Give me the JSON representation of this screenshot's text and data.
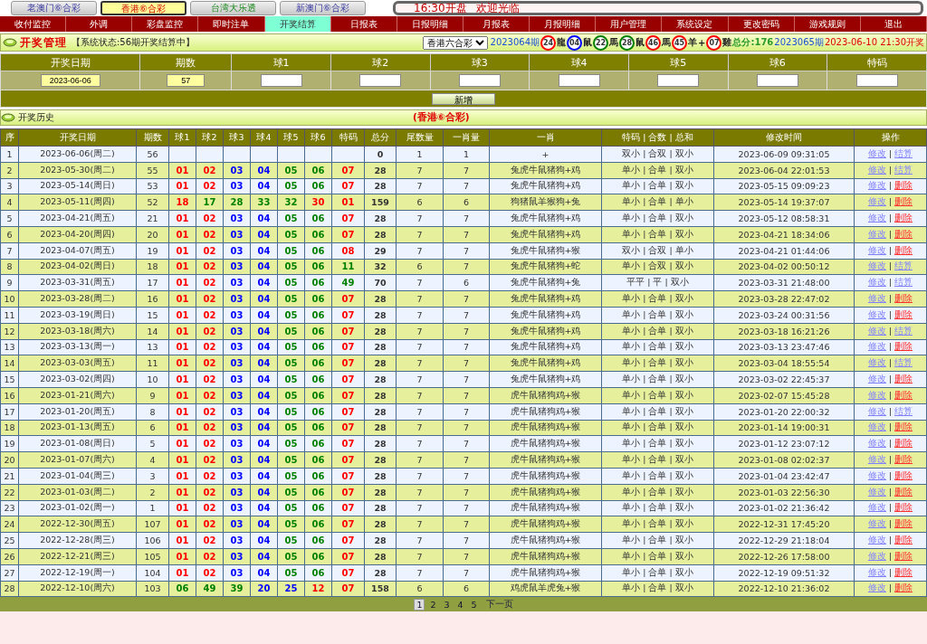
{
  "lottery_tabs": [
    {
      "label": "老澳门⑥合彩",
      "selected": false
    },
    {
      "label": "香港⑥合彩",
      "selected": true
    },
    {
      "label": "台湾大乐透",
      "selected": false
    },
    {
      "label": "新澳门⑥合彩",
      "selected": false
    }
  ],
  "marquee": {
    "time_text": "16:30开盘",
    "welcome": "欢迎光临"
  },
  "nav": [
    {
      "label": "收付监控",
      "selected": false
    },
    {
      "label": "外调",
      "selected": false
    },
    {
      "label": "彩盘监控",
      "selected": false
    },
    {
      "label": "即时注单",
      "selected": false
    },
    {
      "label": "开奖结算",
      "selected": true
    },
    {
      "label": "日报表",
      "selected": false
    },
    {
      "label": "日报明细",
      "selected": false
    },
    {
      "label": "月报表",
      "selected": false
    },
    {
      "label": "月报明细",
      "selected": false
    },
    {
      "label": "用户管理",
      "selected": false
    },
    {
      "label": "系统设定",
      "selected": false
    },
    {
      "label": "更改密码",
      "selected": false
    },
    {
      "label": "游戏规则",
      "selected": false
    },
    {
      "label": "退出",
      "selected": false
    }
  ],
  "status": {
    "title": "开奖管理",
    "system_status": "【系统状态:56期开奖结算中】",
    "lottery_select": "香港六合彩",
    "last_issue": "2023064期",
    "last_balls": [
      {
        "num": "24",
        "zodiac": "龍",
        "color": "#ff0000"
      },
      {
        "num": "04",
        "zodiac": "鼠",
        "color": "#0000ff"
      },
      {
        "num": "22",
        "zodiac": "馬",
        "color": "#008000"
      },
      {
        "num": "28",
        "zodiac": "鼠",
        "color": "#008000"
      },
      {
        "num": "46",
        "zodiac": "馬",
        "color": "#ff0000"
      },
      {
        "num": "45",
        "zodiac": "羊",
        "color": "#ff0000"
      }
    ],
    "plus": "+",
    "special_ball": {
      "num": "07",
      "zodiac": "雞",
      "color": "#ff0000"
    },
    "total": "总分:176",
    "next_issue": "2023065期",
    "next_time": "2023-06-10 21:30开奖"
  },
  "form": {
    "columns": [
      "开奖日期",
      "期数",
      "球1",
      "球2",
      "球3",
      "球4",
      "球5",
      "球6",
      "特码"
    ],
    "date_value": "2023-06-06",
    "issue_value": "57",
    "add_button": "新增"
  },
  "history": {
    "label": "开奖历史",
    "lottery": "(香港⑥合彩)"
  },
  "table": {
    "action_separator": "|",
    "columns": [
      "序",
      "开奖日期",
      "期数",
      "球1",
      "球2",
      "球3",
      "球4",
      "球5",
      "球6",
      "特码",
      "总分",
      "尾数量",
      "一肖量",
      "一肖",
      "特码 | 合数 | 总和",
      "修改时间",
      "操作"
    ],
    "rows": [
      {
        "seq": "1",
        "date": "2023-06-06(周二)",
        "issue": "56",
        "total": "0",
        "tail": "1",
        "zcount": "1",
        "zodiac": "+",
        "summary": "双小 | 合双 | 双小",
        "modified": "2023-06-09 09:31:05",
        "actions": [
          {
            "label": "修改",
            "kind": "edit"
          },
          {
            "label": "结算",
            "kind": "settle"
          }
        ]
      },
      {
        "seq": "2",
        "date": "2023-05-30(周二)",
        "issue": "55",
        "balls": [
          {
            "num": "01",
            "color": "#ff0000"
          },
          {
            "num": "02",
            "color": "#ff0000"
          },
          {
            "num": "03",
            "color": "#0000ff"
          },
          {
            "num": "04",
            "color": "#0000ff"
          },
          {
            "num": "05",
            "color": "#008000"
          },
          {
            "num": "06",
            "color": "#008000"
          },
          {
            "num": "07",
            "color": "#ff0000"
          }
        ],
        "total": "28",
        "tail": "7",
        "zcount": "7",
        "zodiac": "兔虎牛鼠猪狗+鸡",
        "summary": "单小 | 合单 | 双小",
        "modified": "2023-06-04 22:01:53",
        "actions": [
          {
            "label": "修改",
            "kind": "edit"
          },
          {
            "label": "结算",
            "kind": "settle"
          }
        ]
      },
      {
        "seq": "3",
        "date": "2023-05-14(周日)",
        "issue": "53",
        "balls": [
          {
            "num": "01",
            "color": "#ff0000"
          },
          {
            "num": "02",
            "color": "#ff0000"
          },
          {
            "num": "03",
            "color": "#0000ff"
          },
          {
            "num": "04",
            "color": "#0000ff"
          },
          {
            "num": "05",
            "color": "#008000"
          },
          {
            "num": "06",
            "color": "#008000"
          },
          {
            "num": "07",
            "color": "#ff0000"
          }
        ],
        "total": "28",
        "tail": "7",
        "zcount": "7",
        "zodiac": "兔虎牛鼠猪狗+鸡",
        "summary": "单小 | 合单 | 双小",
        "modified": "2023-05-15 09:09:23",
        "actions": [
          {
            "label": "修改",
            "kind": "edit"
          },
          {
            "label": "删除",
            "kind": "delete"
          }
        ]
      },
      {
        "seq": "4",
        "date": "2023-05-11(周四)",
        "issue": "52",
        "balls": [
          {
            "num": "18",
            "color": "#ff0000"
          },
          {
            "num": "17",
            "color": "#008000"
          },
          {
            "num": "28",
            "color": "#008000"
          },
          {
            "num": "33",
            "color": "#008000"
          },
          {
            "num": "32",
            "color": "#008000"
          },
          {
            "num": "30",
            "color": "#ff0000"
          },
          {
            "num": "01",
            "color": "#ff0000"
          }
        ],
        "total": "159",
        "tail": "6",
        "zcount": "6",
        "zodiac": "狗猪鼠羊猴狗+兔",
        "summary": "单小 | 合单 | 单小",
        "modified": "2023-05-14 19:37:07",
        "actions": [
          {
            "label": "修改",
            "kind": "edit"
          },
          {
            "label": "删除",
            "kind": "delete"
          }
        ]
      },
      {
        "seq": "5",
        "date": "2023-04-21(周五)",
        "issue": "21",
        "balls": [
          {
            "num": "01",
            "color": "#ff0000"
          },
          {
            "num": "02",
            "color": "#ff0000"
          },
          {
            "num": "03",
            "color": "#0000ff"
          },
          {
            "num": "04",
            "color": "#0000ff"
          },
          {
            "num": "05",
            "color": "#008000"
          },
          {
            "num": "06",
            "color": "#008000"
          },
          {
            "num": "07",
            "color": "#ff0000"
          }
        ],
        "total": "28",
        "tail": "7",
        "zcount": "7",
        "zodiac": "兔虎牛鼠猪狗+鸡",
        "summary": "单小 | 合单 | 双小",
        "modified": "2023-05-12 08:58:31",
        "actions": [
          {
            "label": "修改",
            "kind": "edit"
          },
          {
            "label": "删除",
            "kind": "delete"
          }
        ]
      },
      {
        "seq": "6",
        "date": "2023-04-20(周四)",
        "issue": "20",
        "balls": [
          {
            "num": "01",
            "color": "#ff0000"
          },
          {
            "num": "02",
            "color": "#ff0000"
          },
          {
            "num": "03",
            "color": "#0000ff"
          },
          {
            "num": "04",
            "color": "#0000ff"
          },
          {
            "num": "05",
            "color": "#008000"
          },
          {
            "num": "06",
            "color": "#008000"
          },
          {
            "num": "07",
            "color": "#ff0000"
          }
        ],
        "total": "28",
        "tail": "7",
        "zcount": "7",
        "zodiac": "兔虎牛鼠猪狗+鸡",
        "summary": "单小 | 合单 | 双小",
        "modified": "2023-04-21 18:34:06",
        "actions": [
          {
            "label": "修改",
            "kind": "edit"
          },
          {
            "label": "删除",
            "kind": "delete"
          }
        ]
      },
      {
        "seq": "7",
        "date": "2023-04-07(周五)",
        "issue": "19",
        "balls": [
          {
            "num": "01",
            "color": "#ff0000"
          },
          {
            "num": "02",
            "color": "#ff0000"
          },
          {
            "num": "03",
            "color": "#0000ff"
          },
          {
            "num": "04",
            "color": "#0000ff"
          },
          {
            "num": "05",
            "color": "#008000"
          },
          {
            "num": "06",
            "color": "#008000"
          },
          {
            "num": "08",
            "color": "#ff0000"
          }
        ],
        "total": "29",
        "tail": "7",
        "zcount": "7",
        "zodiac": "兔虎牛鼠猪狗+猴",
        "summary": "双小 | 合双 | 单小",
        "modified": "2023-04-21 01:44:06",
        "actions": [
          {
            "label": "修改",
            "kind": "edit"
          },
          {
            "label": "删除",
            "kind": "delete"
          }
        ]
      },
      {
        "seq": "8",
        "date": "2023-04-02(周日)",
        "issue": "18",
        "balls": [
          {
            "num": "01",
            "color": "#ff0000"
          },
          {
            "num": "02",
            "color": "#ff0000"
          },
          {
            "num": "03",
            "color": "#0000ff"
          },
          {
            "num": "04",
            "color": "#0000ff"
          },
          {
            "num": "05",
            "color": "#008000"
          },
          {
            "num": "06",
            "color": "#008000"
          },
          {
            "num": "11",
            "color": "#008000"
          }
        ],
        "total": "32",
        "tail": "6",
        "zcount": "7",
        "zodiac": "兔虎牛鼠猪狗+蛇",
        "summary": "单小 | 合双 | 双小",
        "modified": "2023-04-02 00:50:12",
        "actions": [
          {
            "label": "修改",
            "kind": "edit"
          },
          {
            "label": "结算",
            "kind": "settle"
          }
        ]
      },
      {
        "seq": "9",
        "date": "2023-03-31(周五)",
        "issue": "17",
        "balls": [
          {
            "num": "01",
            "color": "#ff0000"
          },
          {
            "num": "02",
            "color": "#ff0000"
          },
          {
            "num": "03",
            "color": "#0000ff"
          },
          {
            "num": "04",
            "color": "#0000ff"
          },
          {
            "num": "05",
            "color": "#008000"
          },
          {
            "num": "06",
            "color": "#008000"
          },
          {
            "num": "49",
            "color": "#008000"
          }
        ],
        "total": "70",
        "tail": "7",
        "zcount": "6",
        "zodiac": "兔虎牛鼠猪狗+兔",
        "summary": "平平 | 平 | 双小",
        "modified": "2023-03-31 21:48:00",
        "actions": [
          {
            "label": "修改",
            "kind": "edit"
          },
          {
            "label": "结算",
            "kind": "settle"
          }
        ]
      },
      {
        "seq": "10",
        "date": "2023-03-28(周二)",
        "issue": "16",
        "balls": [
          {
            "num": "01",
            "color": "#ff0000"
          },
          {
            "num": "02",
            "color": "#ff0000"
          },
          {
            "num": "03",
            "color": "#0000ff"
          },
          {
            "num": "04",
            "color": "#0000ff"
          },
          {
            "num": "05",
            "color": "#008000"
          },
          {
            "num": "06",
            "color": "#008000"
          },
          {
            "num": "07",
            "color": "#ff0000"
          }
        ],
        "total": "28",
        "tail": "7",
        "zcount": "7",
        "zodiac": "兔虎牛鼠猪狗+鸡",
        "summary": "单小 | 合单 | 双小",
        "modified": "2023-03-28 22:47:02",
        "actions": [
          {
            "label": "修改",
            "kind": "edit"
          },
          {
            "label": "删除",
            "kind": "delete"
          }
        ]
      },
      {
        "seq": "11",
        "date": "2023-03-19(周日)",
        "issue": "15",
        "balls": [
          {
            "num": "01",
            "color": "#ff0000"
          },
          {
            "num": "02",
            "color": "#ff0000"
          },
          {
            "num": "03",
            "color": "#0000ff"
          },
          {
            "num": "04",
            "color": "#0000ff"
          },
          {
            "num": "05",
            "color": "#008000"
          },
          {
            "num": "06",
            "color": "#008000"
          },
          {
            "num": "07",
            "color": "#ff0000"
          }
        ],
        "total": "28",
        "tail": "7",
        "zcount": "7",
        "zodiac": "兔虎牛鼠猪狗+鸡",
        "summary": "单小 | 合单 | 双小",
        "modified": "2023-03-24 00:31:56",
        "actions": [
          {
            "label": "修改",
            "kind": "edit"
          },
          {
            "label": "删除",
            "kind": "delete"
          }
        ]
      },
      {
        "seq": "12",
        "date": "2023-03-18(周六)",
        "issue": "14",
        "balls": [
          {
            "num": "01",
            "color": "#ff0000"
          },
          {
            "num": "02",
            "color": "#ff0000"
          },
          {
            "num": "03",
            "color": "#0000ff"
          },
          {
            "num": "04",
            "color": "#0000ff"
          },
          {
            "num": "05",
            "color": "#008000"
          },
          {
            "num": "06",
            "color": "#008000"
          },
          {
            "num": "07",
            "color": "#ff0000"
          }
        ],
        "total": "28",
        "tail": "7",
        "zcount": "7",
        "zodiac": "兔虎牛鼠猪狗+鸡",
        "summary": "单小 | 合单 | 双小",
        "modified": "2023-03-18 16:21:26",
        "actions": [
          {
            "label": "修改",
            "kind": "edit"
          },
          {
            "label": "结算",
            "kind": "settle"
          }
        ]
      },
      {
        "seq": "13",
        "date": "2023-03-13(周一)",
        "issue": "13",
        "balls": [
          {
            "num": "01",
            "color": "#ff0000"
          },
          {
            "num": "02",
            "color": "#ff0000"
          },
          {
            "num": "03",
            "color": "#0000ff"
          },
          {
            "num": "04",
            "color": "#0000ff"
          },
          {
            "num": "05",
            "color": "#008000"
          },
          {
            "num": "06",
            "color": "#008000"
          },
          {
            "num": "07",
            "color": "#ff0000"
          }
        ],
        "total": "28",
        "tail": "7",
        "zcount": "7",
        "zodiac": "兔虎牛鼠猪狗+鸡",
        "summary": "单小 | 合单 | 双小",
        "modified": "2023-03-13 23:47:46",
        "actions": [
          {
            "label": "修改",
            "kind": "edit"
          },
          {
            "label": "删除",
            "kind": "delete"
          }
        ]
      },
      {
        "seq": "14",
        "date": "2023-03-03(周五)",
        "issue": "11",
        "balls": [
          {
            "num": "01",
            "color": "#ff0000"
          },
          {
            "num": "02",
            "color": "#ff0000"
          },
          {
            "num": "03",
            "color": "#0000ff"
          },
          {
            "num": "04",
            "color": "#0000ff"
          },
          {
            "num": "05",
            "color": "#008000"
          },
          {
            "num": "06",
            "color": "#008000"
          },
          {
            "num": "07",
            "color": "#ff0000"
          }
        ],
        "total": "28",
        "tail": "7",
        "zcount": "7",
        "zodiac": "兔虎牛鼠猪狗+鸡",
        "summary": "单小 | 合单 | 双小",
        "modified": "2023-03-04 18:55:54",
        "actions": [
          {
            "label": "修改",
            "kind": "edit"
          },
          {
            "label": "结算",
            "kind": "settle"
          }
        ]
      },
      {
        "seq": "15",
        "date": "2023-03-02(周四)",
        "issue": "10",
        "balls": [
          {
            "num": "01",
            "color": "#ff0000"
          },
          {
            "num": "02",
            "color": "#ff0000"
          },
          {
            "num": "03",
            "color": "#0000ff"
          },
          {
            "num": "04",
            "color": "#0000ff"
          },
          {
            "num": "05",
            "color": "#008000"
          },
          {
            "num": "06",
            "color": "#008000"
          },
          {
            "num": "07",
            "color": "#ff0000"
          }
        ],
        "total": "28",
        "tail": "7",
        "zcount": "7",
        "zodiac": "兔虎牛鼠猪狗+鸡",
        "summary": "单小 | 合单 | 双小",
        "modified": "2023-03-02 22:45:37",
        "actions": [
          {
            "label": "修改",
            "kind": "edit"
          },
          {
            "label": "删除",
            "kind": "delete"
          }
        ]
      },
      {
        "seq": "16",
        "date": "2023-01-21(周六)",
        "issue": "9",
        "balls": [
          {
            "num": "01",
            "color": "#ff0000"
          },
          {
            "num": "02",
            "color": "#ff0000"
          },
          {
            "num": "03",
            "color": "#0000ff"
          },
          {
            "num": "04",
            "color": "#0000ff"
          },
          {
            "num": "05",
            "color": "#008000"
          },
          {
            "num": "06",
            "color": "#008000"
          },
          {
            "num": "07",
            "color": "#ff0000"
          }
        ],
        "total": "28",
        "tail": "7",
        "zcount": "7",
        "zodiac": "虎牛鼠猪狗鸡+猴",
        "summary": "单小 | 合单 | 双小",
        "modified": "2023-02-07 15:45:28",
        "actions": [
          {
            "label": "修改",
            "kind": "edit"
          },
          {
            "label": "删除",
            "kind": "delete"
          }
        ]
      },
      {
        "seq": "17",
        "date": "2023-01-20(周五)",
        "issue": "8",
        "balls": [
          {
            "num": "01",
            "color": "#ff0000"
          },
          {
            "num": "02",
            "color": "#ff0000"
          },
          {
            "num": "03",
            "color": "#0000ff"
          },
          {
            "num": "04",
            "color": "#0000ff"
          },
          {
            "num": "05",
            "color": "#008000"
          },
          {
            "num": "06",
            "color": "#008000"
          },
          {
            "num": "07",
            "color": "#ff0000"
          }
        ],
        "total": "28",
        "tail": "7",
        "zcount": "7",
        "zodiac": "虎牛鼠猪狗鸡+猴",
        "summary": "单小 | 合单 | 双小",
        "modified": "2023-01-20 22:00:32",
        "actions": [
          {
            "label": "修改",
            "kind": "edit"
          },
          {
            "label": "结算",
            "kind": "settle"
          }
        ]
      },
      {
        "seq": "18",
        "date": "2023-01-13(周五)",
        "issue": "6",
        "balls": [
          {
            "num": "01",
            "color": "#ff0000"
          },
          {
            "num": "02",
            "color": "#ff0000"
          },
          {
            "num": "03",
            "color": "#0000ff"
          },
          {
            "num": "04",
            "color": "#0000ff"
          },
          {
            "num": "05",
            "color": "#008000"
          },
          {
            "num": "06",
            "color": "#008000"
          },
          {
            "num": "07",
            "color": "#ff0000"
          }
        ],
        "total": "28",
        "tail": "7",
        "zcount": "7",
        "zodiac": "虎牛鼠猪狗鸡+猴",
        "summary": "单小 | 合单 | 双小",
        "modified": "2023-01-14 19:00:31",
        "actions": [
          {
            "label": "修改",
            "kind": "edit"
          },
          {
            "label": "删除",
            "kind": "delete"
          }
        ]
      },
      {
        "seq": "19",
        "date": "2023-01-08(周日)",
        "issue": "5",
        "balls": [
          {
            "num": "01",
            "color": "#ff0000"
          },
          {
            "num": "02",
            "color": "#ff0000"
          },
          {
            "num": "03",
            "color": "#0000ff"
          },
          {
            "num": "04",
            "color": "#0000ff"
          },
          {
            "num": "05",
            "color": "#008000"
          },
          {
            "num": "06",
            "color": "#008000"
          },
          {
            "num": "07",
            "color": "#ff0000"
          }
        ],
        "total": "28",
        "tail": "7",
        "zcount": "7",
        "zodiac": "虎牛鼠猪狗鸡+猴",
        "summary": "单小 | 合单 | 双小",
        "modified": "2023-01-12 23:07:12",
        "actions": [
          {
            "label": "修改",
            "kind": "edit"
          },
          {
            "label": "删除",
            "kind": "delete"
          }
        ]
      },
      {
        "seq": "20",
        "date": "2023-01-07(周六)",
        "issue": "4",
        "balls": [
          {
            "num": "01",
            "color": "#ff0000"
          },
          {
            "num": "02",
            "color": "#ff0000"
          },
          {
            "num": "03",
            "color": "#0000ff"
          },
          {
            "num": "04",
            "color": "#0000ff"
          },
          {
            "num": "05",
            "color": "#008000"
          },
          {
            "num": "06",
            "color": "#008000"
          },
          {
            "num": "07",
            "color": "#ff0000"
          }
        ],
        "total": "28",
        "tail": "7",
        "zcount": "7",
        "zodiac": "虎牛鼠猪狗鸡+猴",
        "summary": "单小 | 合单 | 双小",
        "modified": "2023-01-08 02:02:37",
        "actions": [
          {
            "label": "修改",
            "kind": "edit"
          },
          {
            "label": "删除",
            "kind": "delete"
          }
        ]
      },
      {
        "seq": "21",
        "date": "2023-01-04(周三)",
        "issue": "3",
        "balls": [
          {
            "num": "01",
            "color": "#ff0000"
          },
          {
            "num": "02",
            "color": "#ff0000"
          },
          {
            "num": "03",
            "color": "#0000ff"
          },
          {
            "num": "04",
            "color": "#0000ff"
          },
          {
            "num": "05",
            "color": "#008000"
          },
          {
            "num": "06",
            "color": "#008000"
          },
          {
            "num": "07",
            "color": "#ff0000"
          }
        ],
        "total": "28",
        "tail": "7",
        "zcount": "7",
        "zodiac": "虎牛鼠猪狗鸡+猴",
        "summary": "单小 | 合单 | 双小",
        "modified": "2023-01-04 23:42:47",
        "actions": [
          {
            "label": "修改",
            "kind": "edit"
          },
          {
            "label": "删除",
            "kind": "delete"
          }
        ]
      },
      {
        "seq": "22",
        "date": "2023-01-03(周二)",
        "issue": "2",
        "balls": [
          {
            "num": "01",
            "color": "#ff0000"
          },
          {
            "num": "02",
            "color": "#ff0000"
          },
          {
            "num": "03",
            "color": "#0000ff"
          },
          {
            "num": "04",
            "color": "#0000ff"
          },
          {
            "num": "05",
            "color": "#008000"
          },
          {
            "num": "06",
            "color": "#008000"
          },
          {
            "num": "07",
            "color": "#ff0000"
          }
        ],
        "total": "28",
        "tail": "7",
        "zcount": "7",
        "zodiac": "虎牛鼠猪狗鸡+猴",
        "summary": "单小 | 合单 | 双小",
        "modified": "2023-01-03 22:56:30",
        "actions": [
          {
            "label": "修改",
            "kind": "edit"
          },
          {
            "label": "删除",
            "kind": "delete"
          }
        ]
      },
      {
        "seq": "23",
        "date": "2023-01-02(周一)",
        "issue": "1",
        "balls": [
          {
            "num": "01",
            "color": "#ff0000"
          },
          {
            "num": "02",
            "color": "#ff0000"
          },
          {
            "num": "03",
            "color": "#0000ff"
          },
          {
            "num": "04",
            "color": "#0000ff"
          },
          {
            "num": "05",
            "color": "#008000"
          },
          {
            "num": "06",
            "color": "#008000"
          },
          {
            "num": "07",
            "color": "#ff0000"
          }
        ],
        "total": "28",
        "tail": "7",
        "zcount": "7",
        "zodiac": "虎牛鼠猪狗鸡+猴",
        "summary": "单小 | 合单 | 双小",
        "modified": "2023-01-02 21:36:42",
        "actions": [
          {
            "label": "修改",
            "kind": "edit"
          },
          {
            "label": "删除",
            "kind": "delete"
          }
        ]
      },
      {
        "seq": "24",
        "date": "2022-12-30(周五)",
        "issue": "107",
        "balls": [
          {
            "num": "01",
            "color": "#ff0000"
          },
          {
            "num": "02",
            "color": "#ff0000"
          },
          {
            "num": "03",
            "color": "#0000ff"
          },
          {
            "num": "04",
            "color": "#0000ff"
          },
          {
            "num": "05",
            "color": "#008000"
          },
          {
            "num": "06",
            "color": "#008000"
          },
          {
            "num": "07",
            "color": "#ff0000"
          }
        ],
        "total": "28",
        "tail": "7",
        "zcount": "7",
        "zodiac": "虎牛鼠猪狗鸡+猴",
        "summary": "单小 | 合单 | 双小",
        "modified": "2022-12-31 17:45:20",
        "actions": [
          {
            "label": "修改",
            "kind": "edit"
          },
          {
            "label": "删除",
            "kind": "delete"
          }
        ]
      },
      {
        "seq": "25",
        "date": "2022-12-28(周三)",
        "issue": "106",
        "balls": [
          {
            "num": "01",
            "color": "#ff0000"
          },
          {
            "num": "02",
            "color": "#ff0000"
          },
          {
            "num": "03",
            "color": "#0000ff"
          },
          {
            "num": "04",
            "color": "#0000ff"
          },
          {
            "num": "05",
            "color": "#008000"
          },
          {
            "num": "06",
            "color": "#008000"
          },
          {
            "num": "07",
            "color": "#ff0000"
          }
        ],
        "total": "28",
        "tail": "7",
        "zcount": "7",
        "zodiac": "虎牛鼠猪狗鸡+猴",
        "summary": "单小 | 合单 | 双小",
        "modified": "2022-12-29 21:18:04",
        "actions": [
          {
            "label": "修改",
            "kind": "edit"
          },
          {
            "label": "删除",
            "kind": "delete"
          }
        ]
      },
      {
        "seq": "26",
        "date": "2022-12-21(周三)",
        "issue": "105",
        "balls": [
          {
            "num": "01",
            "color": "#ff0000"
          },
          {
            "num": "02",
            "color": "#ff0000"
          },
          {
            "num": "03",
            "color": "#0000ff"
          },
          {
            "num": "04",
            "color": "#0000ff"
          },
          {
            "num": "05",
            "color": "#008000"
          },
          {
            "num": "06",
            "color": "#008000"
          },
          {
            "num": "07",
            "color": "#ff0000"
          }
        ],
        "total": "28",
        "tail": "7",
        "zcount": "7",
        "zodiac": "虎牛鼠猪狗鸡+猴",
        "summary": "单小 | 合单 | 双小",
        "modified": "2022-12-26 17:58:00",
        "actions": [
          {
            "label": "修改",
            "kind": "edit"
          },
          {
            "label": "删除",
            "kind": "delete"
          }
        ]
      },
      {
        "seq": "27",
        "date": "2022-12-19(周一)",
        "issue": "104",
        "balls": [
          {
            "num": "01",
            "color": "#ff0000"
          },
          {
            "num": "02",
            "color": "#ff0000"
          },
          {
            "num": "03",
            "color": "#0000ff"
          },
          {
            "num": "04",
            "color": "#0000ff"
          },
          {
            "num": "05",
            "color": "#008000"
          },
          {
            "num": "06",
            "color": "#008000"
          },
          {
            "num": "07",
            "color": "#ff0000"
          }
        ],
        "total": "28",
        "tail": "7",
        "zcount": "7",
        "zodiac": "虎牛鼠猪狗鸡+猴",
        "summary": "单小 | 合单 | 双小",
        "modified": "2022-12-19 09:51:32",
        "actions": [
          {
            "label": "修改",
            "kind": "edit"
          },
          {
            "label": "删除",
            "kind": "delete"
          }
        ]
      },
      {
        "seq": "28",
        "date": "2022-12-10(周六)",
        "issue": "103",
        "balls": [
          {
            "num": "06",
            "color": "#008000"
          },
          {
            "num": "49",
            "color": "#008000"
          },
          {
            "num": "39",
            "color": "#008000"
          },
          {
            "num": "20",
            "color": "#0000ff"
          },
          {
            "num": "25",
            "color": "#0000ff"
          },
          {
            "num": "12",
            "color": "#ff0000"
          },
          {
            "num": "07",
            "color": "#ff0000"
          }
        ],
        "total": "158",
        "tail": "6",
        "zcount": "6",
        "zodiac": "鸡虎鼠羊虎兔+猴",
        "summary": "单小 | 合单 | 双小",
        "modified": "2022-12-10 21:36:02",
        "actions": [
          {
            "label": "修改",
            "kind": "edit"
          },
          {
            "label": "删除",
            "kind": "delete"
          }
        ]
      }
    ]
  },
  "pagination": {
    "pages": [
      {
        "label": "1",
        "selected": true
      },
      {
        "label": "2",
        "selected": false
      },
      {
        "label": "3",
        "selected": false
      },
      {
        "label": "4",
        "selected": false
      },
      {
        "label": "5",
        "selected": false
      }
    ],
    "next": "下一页"
  }
}
